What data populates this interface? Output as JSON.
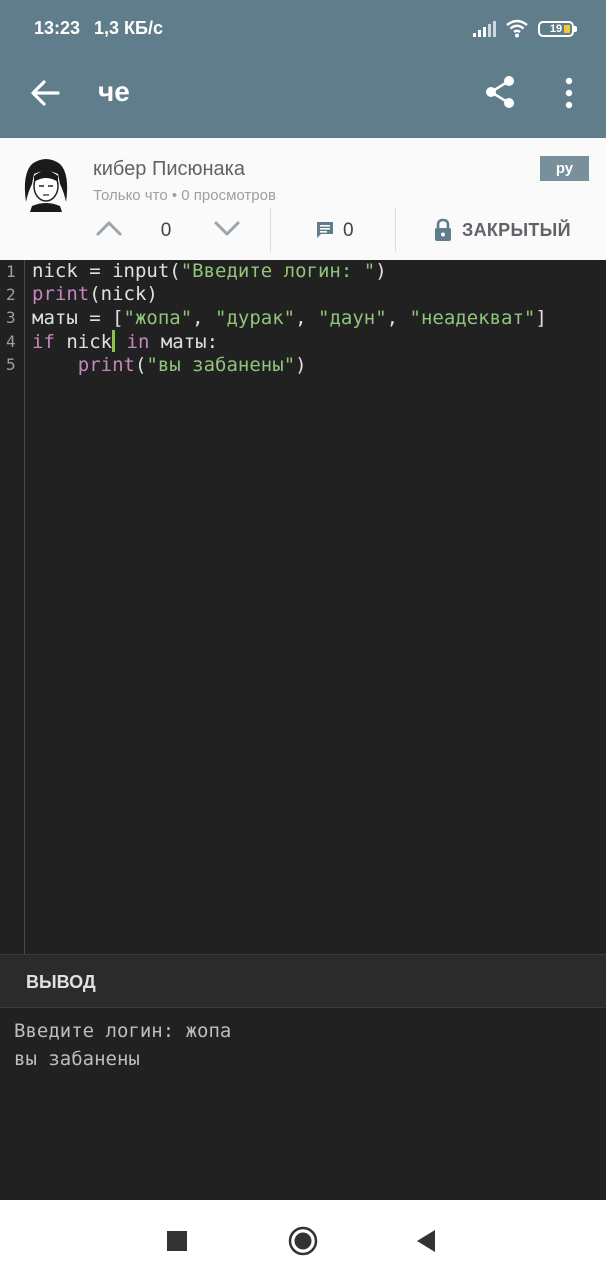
{
  "status_bar": {
    "time": "13:23",
    "speed": "1,3 КБ/с",
    "battery": "19",
    "icons": [
      "signal-icon",
      "wifi-icon",
      "battery-icon"
    ]
  },
  "app_bar": {
    "title": "че",
    "color": "#607d8b"
  },
  "post": {
    "author": "кибер Писюнака",
    "meta": "Только что • 0 просмотров",
    "language": "ру",
    "votes": "0",
    "comments": "0",
    "status": "ЗАКРЫТЫЙ"
  },
  "editor": {
    "line_numbers": [
      "1",
      "2",
      "3",
      "4",
      "5"
    ],
    "lines": [
      [
        {
          "t": "nick = input(",
          "c": ""
        },
        {
          "t": "\"Введите логин: \"",
          "c": "str"
        },
        {
          "t": ")",
          "c": ""
        }
      ],
      [
        {
          "t": "print",
          "c": "fn"
        },
        {
          "t": "(nick)",
          "c": ""
        }
      ],
      [
        {
          "t": "маты = [",
          "c": ""
        },
        {
          "t": "\"жопа\"",
          "c": "str"
        },
        {
          "t": ", ",
          "c": ""
        },
        {
          "t": "\"дурак\"",
          "c": "str"
        },
        {
          "t": ", ",
          "c": ""
        },
        {
          "t": "\"даун\"",
          "c": "str"
        },
        {
          "t": ", ",
          "c": ""
        },
        {
          "t": "\"неадекват\"",
          "c": "str"
        },
        {
          "t": "]",
          "c": ""
        }
      ],
      [
        {
          "t": "if",
          "c": "kw"
        },
        {
          "t": " nick",
          "c": ""
        },
        {
          "t": "",
          "c": "cursor"
        },
        {
          "t": " in",
          "c": "kw"
        },
        {
          "t": " маты:",
          "c": ""
        }
      ],
      [
        {
          "t": "    ",
          "c": ""
        },
        {
          "t": "print",
          "c": "fn"
        },
        {
          "t": "(",
          "c": ""
        },
        {
          "t": "\"вы забанены\"",
          "c": "str"
        },
        {
          "t": ")",
          "c": ""
        }
      ]
    ]
  },
  "output": {
    "title": "ВЫВОД",
    "lines": [
      "Введите логин: жопа",
      "вы забанены"
    ]
  },
  "navbar": {
    "buttons": [
      "recent-apps-icon",
      "home-icon",
      "back-icon"
    ]
  }
}
